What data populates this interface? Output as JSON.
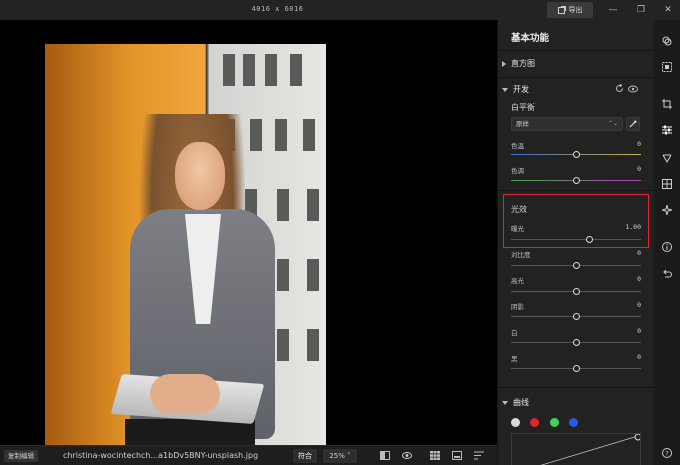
{
  "window": {
    "dimensions": "4016 x 6016",
    "export_label": "导出"
  },
  "panel": {
    "title": "基本功能",
    "sections": {
      "histogram": "直方图",
      "develop": "开发",
      "curves": "曲线"
    },
    "white_balance": {
      "label": "白平衡",
      "selected": "原样",
      "temperature": {
        "label": "色温",
        "value": "0",
        "level": 0.5
      },
      "tint": {
        "label": "色调",
        "value": "0",
        "level": 0.5
      }
    },
    "light": {
      "label": "光效",
      "exposure": {
        "label": "曝光",
        "value": "1.00",
        "level": 0.6
      },
      "contrast": {
        "label": "对比度",
        "value": "0",
        "level": 0.5
      },
      "highlights": {
        "label": "高光",
        "value": "0",
        "level": 0.5
      },
      "shadows": {
        "label": "阴影",
        "value": "0",
        "level": 0.5
      },
      "whites": {
        "label": "白",
        "value": "0",
        "level": 0.5
      },
      "blacks": {
        "label": "黑",
        "value": "0",
        "level": 0.5
      }
    }
  },
  "bottombar": {
    "copy_edit": "复制编辑",
    "filename": "christina-wocintechch...a1bDv5BNY-unsplash.jpg",
    "fit": "符合",
    "zoom": "25%"
  },
  "colors": {
    "accent_highlight": "#e0252e",
    "channel_white": "#d9d9d9",
    "channel_red": "#e0252e",
    "channel_green": "#3ed65a",
    "channel_blue": "#1f5ce8"
  }
}
